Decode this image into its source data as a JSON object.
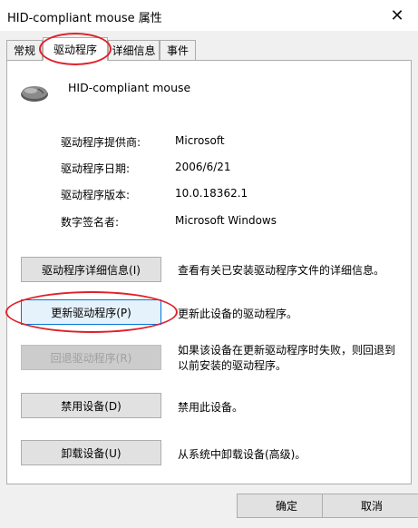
{
  "window": {
    "title": "HID-compliant mouse 属性",
    "close_glyph": "✕"
  },
  "tabs": [
    {
      "label": "常规"
    },
    {
      "label": "驱动程序"
    },
    {
      "label": "详细信息"
    },
    {
      "label": "事件"
    }
  ],
  "device": {
    "name": "HID-compliant mouse",
    "icon": "mouse-icon"
  },
  "info": [
    {
      "label": "驱动程序提供商:",
      "value": "Microsoft"
    },
    {
      "label": "驱动程序日期:",
      "value": "2006/6/21"
    },
    {
      "label": "驱动程序版本:",
      "value": "10.0.18362.1"
    },
    {
      "label": "数字签名者:",
      "value": "Microsoft Windows"
    }
  ],
  "actions": [
    {
      "button": "驱动程序详细信息(I)",
      "description": "查看有关已安装驱动程序文件的详细信息。"
    },
    {
      "button": "更新驱动程序(P)",
      "description": "更新此设备的驱动程序。"
    },
    {
      "button": "回退驱动程序(R)",
      "description": "如果该设备在更新驱动程序时失败，则回退到以前安装的驱动程序。"
    },
    {
      "button": "禁用设备(D)",
      "description": "禁用此设备。"
    },
    {
      "button": "卸载设备(U)",
      "description": "从系统中卸载设备(高级)。"
    }
  ],
  "footer": {
    "ok": "确定",
    "cancel": "取消"
  },
  "colors": {
    "annotation": "#e0202a",
    "focus_border": "#0078d7"
  }
}
